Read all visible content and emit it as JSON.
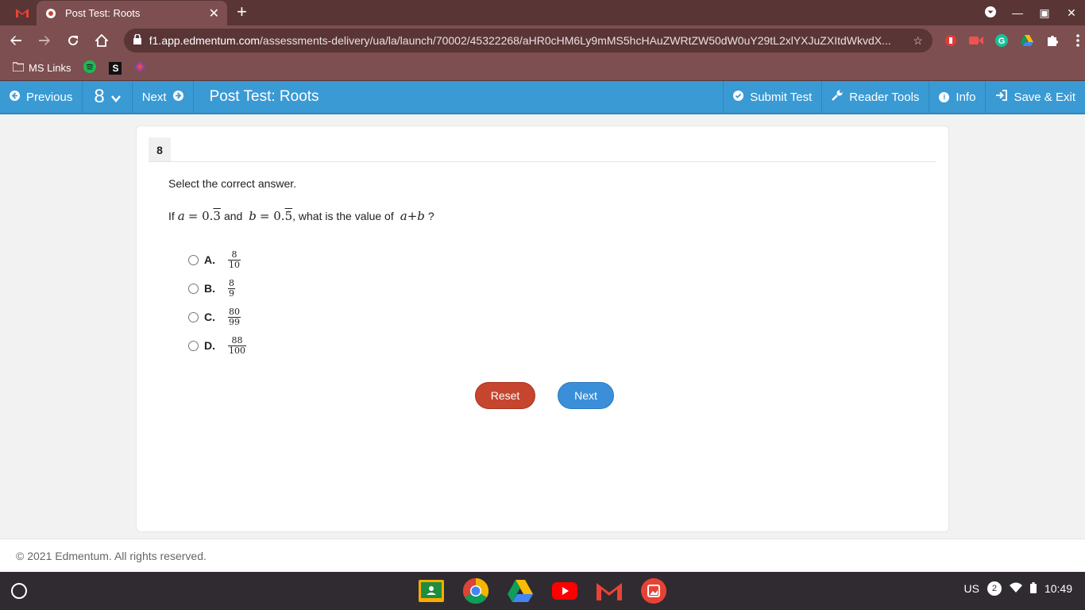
{
  "browser": {
    "tab_title": "Post Test: Roots",
    "url_host": "f1.app.edmentum.com",
    "url_path": "/assessments-delivery/ua/la/launch/70002/45322268/aHR0cHM6Ly9mMS5hcHAuZWRtZW50dW0uY29tL2xlYXJuZXItdWkvdX..."
  },
  "bookmarks": {
    "ms_links": "MS Links",
    "s_label": "S"
  },
  "header": {
    "previous": "Previous",
    "question_number": "8",
    "next": "Next",
    "title": "Post Test: Roots",
    "submit": "Submit Test",
    "reader_tools": "Reader Tools",
    "info": "Info",
    "save_exit": "Save & Exit"
  },
  "question": {
    "number": "8",
    "instruction": "Select the correct answer.",
    "text_if": "If",
    "var_a": "a",
    "eq_a": "= 0.",
    "rep_a": "3",
    "text_and": "and",
    "var_b": "b",
    "eq_b": "= 0.",
    "rep_b": "5",
    "text_what": ", what is the value of",
    "expr": "a+b",
    "text_q": "?",
    "options": [
      {
        "label": "A.",
        "num": "8",
        "den": "10"
      },
      {
        "label": "B.",
        "num": "8",
        "den": "9"
      },
      {
        "label": "C.",
        "num": "80",
        "den": "99"
      },
      {
        "label": "D.",
        "num": "88",
        "den": "100"
      }
    ],
    "reset": "Reset",
    "next": "Next"
  },
  "footer": {
    "copyright": "© 2021 Edmentum. All rights reserved."
  },
  "shelf": {
    "locale": "US",
    "notifications": "2",
    "time": "10:49"
  }
}
